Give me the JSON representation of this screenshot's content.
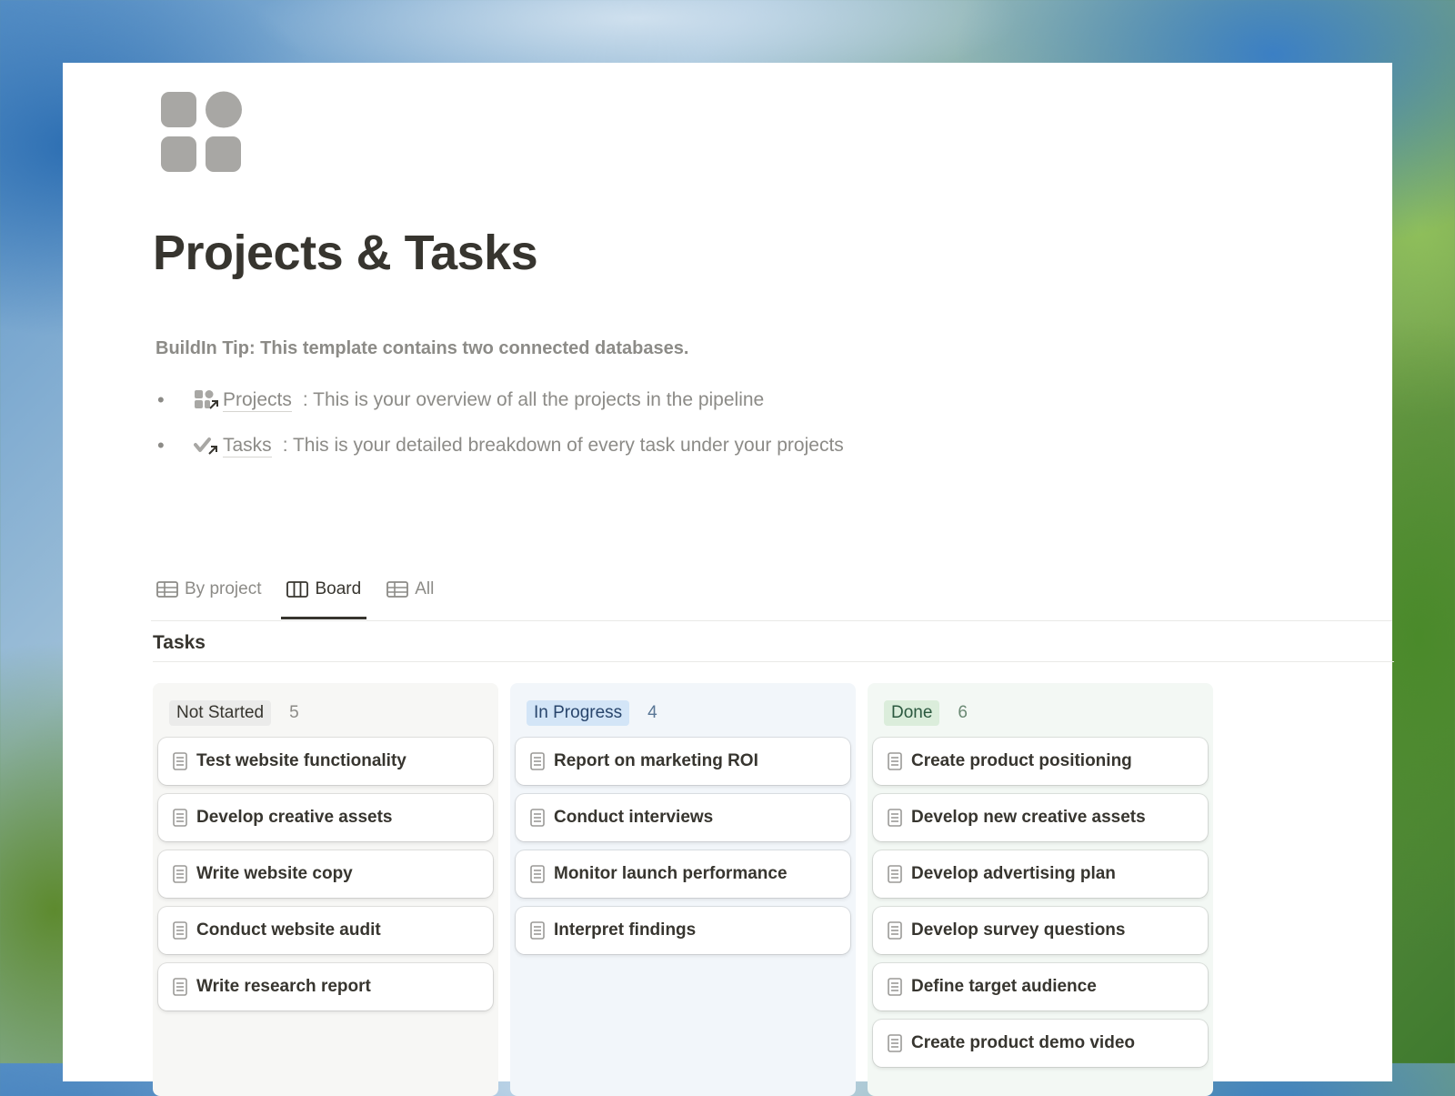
{
  "page": {
    "title": "Projects & Tasks",
    "icon": "grid-blocks-icon"
  },
  "tip": "BuildIn Tip: This template contains two connected databases.",
  "bullets": [
    {
      "icon": "projects-link-icon",
      "link": "Projects",
      "text": ": This is your overview of all the projects in the pipeline"
    },
    {
      "icon": "tasks-link-icon",
      "link": "Tasks",
      "text": ": This is your detailed breakdown of every task under your projects"
    }
  ],
  "tabs": [
    {
      "label": "By project",
      "icon": "table-icon",
      "active": false
    },
    {
      "label": "Board",
      "icon": "board-icon",
      "active": true
    },
    {
      "label": "All",
      "icon": "table-icon",
      "active": false
    }
  ],
  "database": {
    "title": "Tasks"
  },
  "colors": {
    "not_started": {
      "column_bg": "#f7f7f5",
      "pill_bg": "#ebebea",
      "pill_text": "#37352f"
    },
    "in_progress": {
      "column_bg": "#f2f6fa",
      "pill_bg": "#d3e5f7",
      "pill_text": "#28456c"
    },
    "done": {
      "column_bg": "#f3f8f4",
      "pill_bg": "#dbeddb",
      "pill_text": "#2b593f"
    }
  },
  "columns": [
    {
      "status": "Not Started",
      "count": "5",
      "cards": [
        "Test website functionality",
        "Develop creative assets",
        "Write website copy",
        "Conduct website audit",
        "Write research report"
      ]
    },
    {
      "status": "In Progress",
      "count": "4",
      "cards": [
        "Report on marketing ROI",
        "Conduct interviews",
        "Monitor launch performance",
        "Interpret findings"
      ]
    },
    {
      "status": "Done",
      "count": "6",
      "cards": [
        "Create product positioning",
        "Develop new creative assets",
        "Develop advertising plan",
        "Develop survey questions",
        "Define target audience",
        "Create product demo video"
      ]
    }
  ]
}
